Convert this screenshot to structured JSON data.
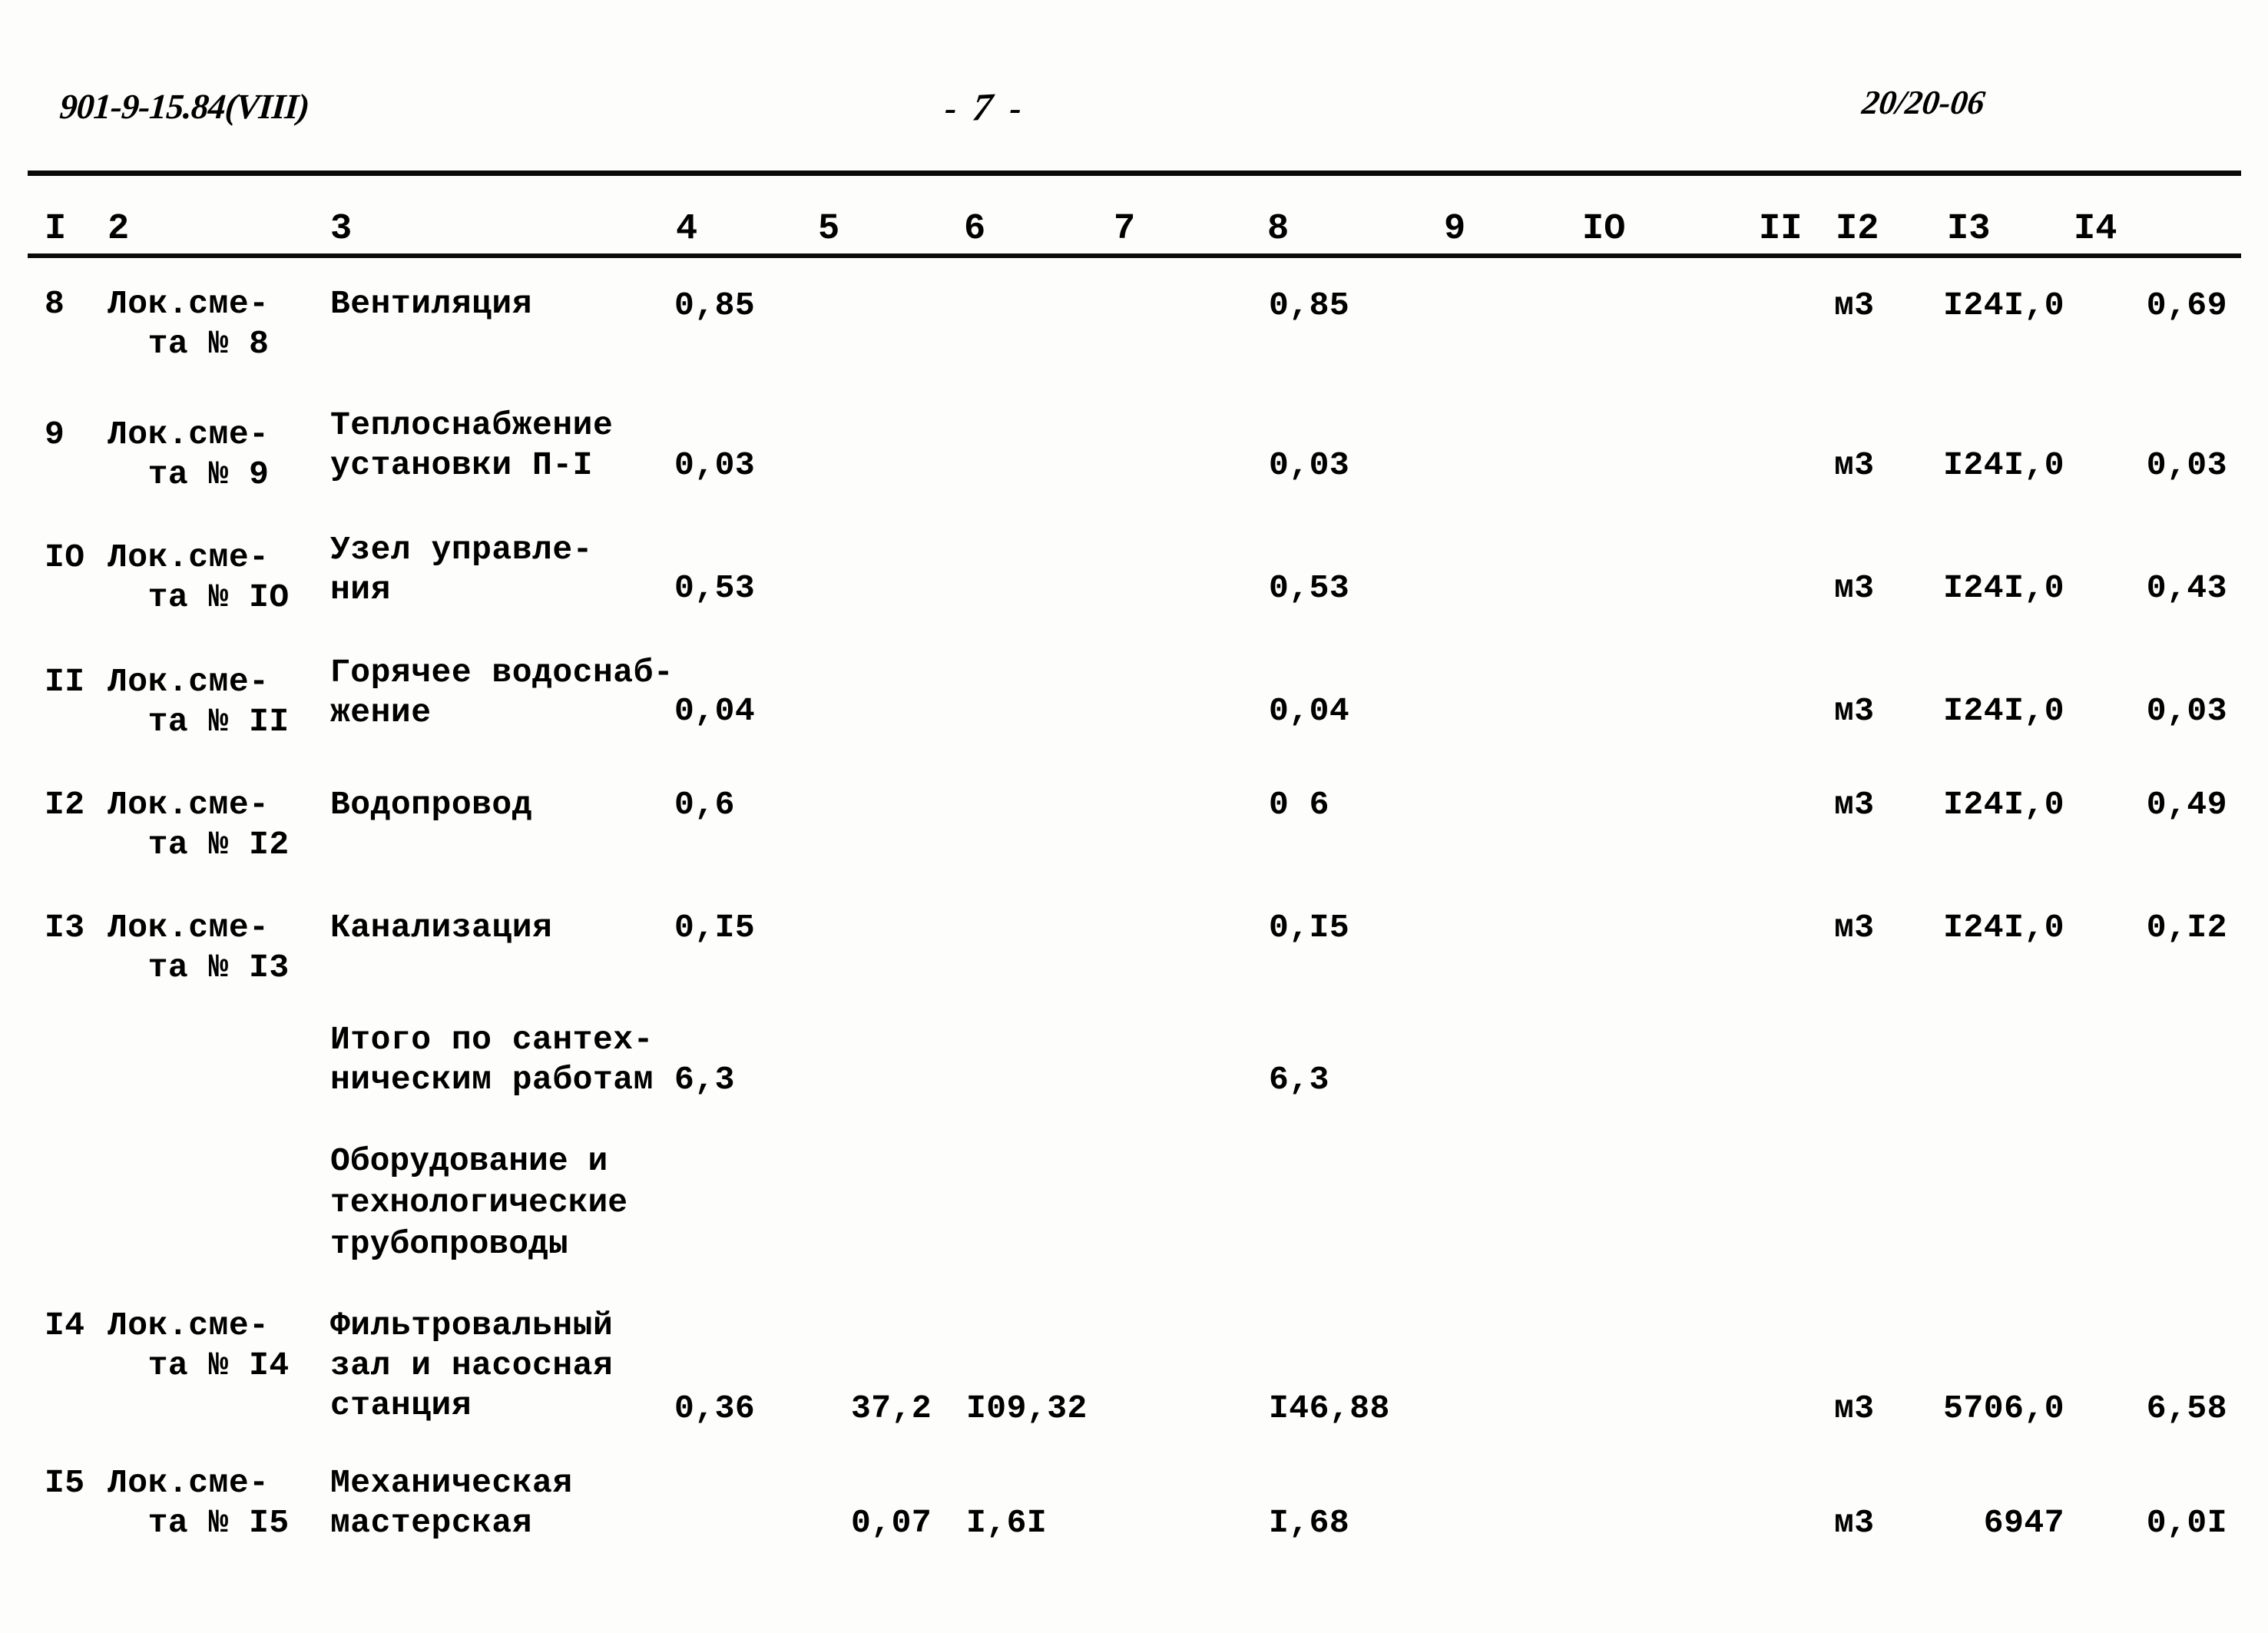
{
  "header": {
    "doc_code": "901-9-15.84(VIII)",
    "page_label_left": "-",
    "page_number": "7",
    "page_label_right": "-",
    "sheet_code": "20/20-06"
  },
  "table": {
    "column_numbers": [
      "I",
      "2",
      "3",
      "4",
      "5",
      "6",
      "7",
      "8",
      "9",
      "IO",
      "II",
      "I2",
      "I3",
      "I4"
    ],
    "rows": [
      {
        "no": "8",
        "estimate": "Лок.сме-\n  та № 8",
        "description": "Вентиляция",
        "col4": "0,85",
        "col5": "",
        "col6": "",
        "col8": "0,85",
        "col12": "м3",
        "col13": "I24I,0",
        "col14": "0,69"
      },
      {
        "no": "9",
        "estimate": "Лок.сме-\n  та № 9",
        "description": "Теплоснабжение\nустановки П-I",
        "col4": "0,03",
        "col5": "",
        "col6": "",
        "col8": "0,03",
        "col12": "м3",
        "col13": "I24I,0",
        "col14": "0,03"
      },
      {
        "no": "IO",
        "estimate": "Лок.сме-\n  та № IO",
        "description": "Узел управле-\nния",
        "col4": "0,53",
        "col5": "",
        "col6": "",
        "col8": "0,53",
        "col12": "м3",
        "col13": "I24I,0",
        "col14": "0,43"
      },
      {
        "no": "II",
        "estimate": "Лок.сме-\n  та № II",
        "description": "Горячее водоснаб-\nжение",
        "col4": "0,04",
        "col5": "",
        "col6": "",
        "col8": "0,04",
        "col12": "м3",
        "col13": "I24I,0",
        "col14": "0,03"
      },
      {
        "no": "I2",
        "estimate": "Лок.сме-\n  та № I2",
        "description": "Водопровод",
        "col4": "0,6",
        "col5": "",
        "col6": "",
        "col8": "0 6",
        "col12": "м3",
        "col13": "I24I,0",
        "col14": "0,49"
      },
      {
        "no": "I3",
        "estimate": "Лок.сме-\n  та № I3",
        "description": "Канализация",
        "col4": "0,I5",
        "col5": "",
        "col6": "",
        "col8": "0,I5",
        "col12": "м3",
        "col13": "I24I,0",
        "col14": "0,I2"
      },
      {
        "no": "",
        "estimate": "",
        "description": "Итого по сантех-\nническим работам",
        "col4": "6,3",
        "col5": "",
        "col6": "",
        "col8": "6,3",
        "col12": "",
        "col13": "",
        "col14": ""
      },
      {
        "no": "I4",
        "estimate": "Лок.сме-\n  та № I4",
        "description": "Фильтровальный\nзал и насосная\nстанция",
        "col4": "0,36",
        "col5": "37,2",
        "col6": "I09,32",
        "col8": "I46,88",
        "col12": "м3",
        "col13": "5706,0",
        "col14": "6,58"
      },
      {
        "no": "I5",
        "estimate": "Лок.сме-\n  та № I5",
        "description": "Механическая\nмастерская",
        "col4": "",
        "col5": "0,07",
        "col6": "I,6I",
        "col8": "I,68",
        "col12": "м3",
        "col13": "6947",
        "col14": "0,0I"
      }
    ],
    "section_heading": "Оборудование и\nтехнологические\nтрубопроводы"
  }
}
